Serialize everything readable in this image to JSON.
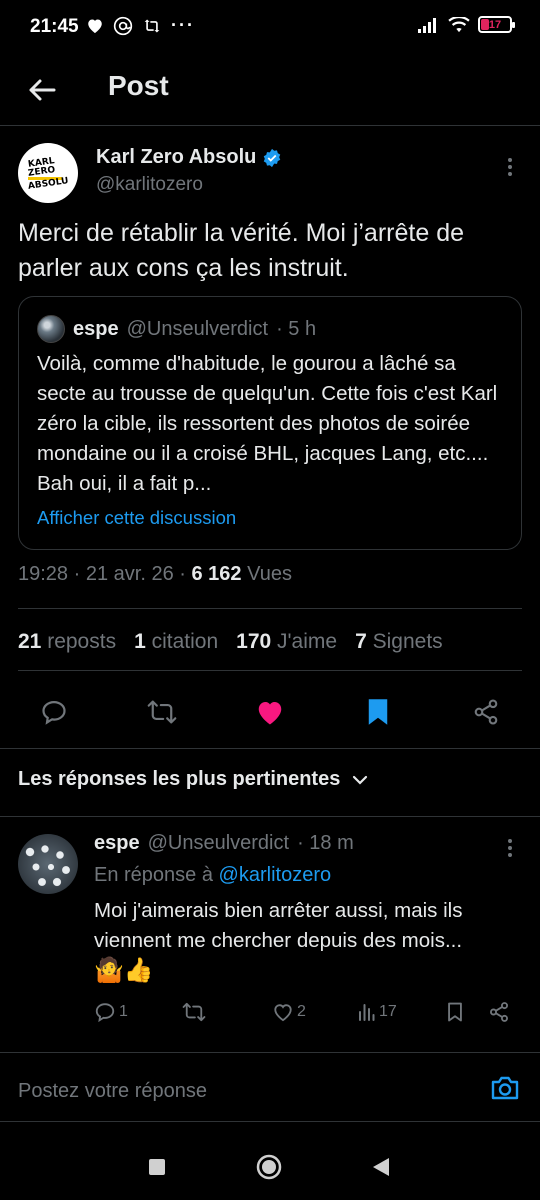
{
  "status_bar": {
    "time": "21:45",
    "battery": "17"
  },
  "header": {
    "title": "Post"
  },
  "tweet": {
    "avatar_logo_lines": [
      "KARL",
      "ZERO",
      "ABSOLU"
    ],
    "author_name": "Karl Zero Absolu",
    "author_handle": "@karlitozero",
    "text": "Merci de rétablir la vérité. Moi j’arrête de parler aux cons ça les instruit.",
    "quote": {
      "name": "espe",
      "handle": "@Unseulverdict",
      "time": "· 5 h",
      "text": "Voilà, comme d'habitude, le gourou a lâché sa secte au trousse de quelqu'un. Cette fois c'est Karl zéro la cible, ils ressortent des photos de soirée mondaine ou il a croisé BHL, jacques Lang, etc.... Bah oui, il a fait p...",
      "link": "Afficher cette discussion"
    },
    "meta": {
      "time": "19:28",
      "date": "21 avr. 26",
      "views_count": "6 162",
      "views_label": "Vues"
    },
    "stats": {
      "reposts_count": "21",
      "reposts_label": "reposts",
      "quotes_count": "1",
      "quotes_label": "citation",
      "likes_count": "170",
      "likes_label": "J'aime",
      "bookmarks_count": "7",
      "bookmarks_label": "Signets"
    },
    "colors": {
      "like": "#f91880",
      "bookmark": "#1d9bf0",
      "link": "#1d9bf0"
    }
  },
  "replies_sort": {
    "label": "Les réponses les plus pertinentes"
  },
  "reply": {
    "name": "espe",
    "handle": "@Unseulverdict",
    "time": "· 18 m",
    "in_reply_prefix": "En réponse à",
    "in_reply_handle": "@karlitozero",
    "text": "Moi j'aimerais bien arrêter aussi, mais ils viennent me chercher depuis des mois...",
    "emoji": "🤷👍",
    "reply_count": "1",
    "like_count": "2",
    "views_count": "17"
  },
  "compose": {
    "placeholder": "Postez votre réponse"
  }
}
